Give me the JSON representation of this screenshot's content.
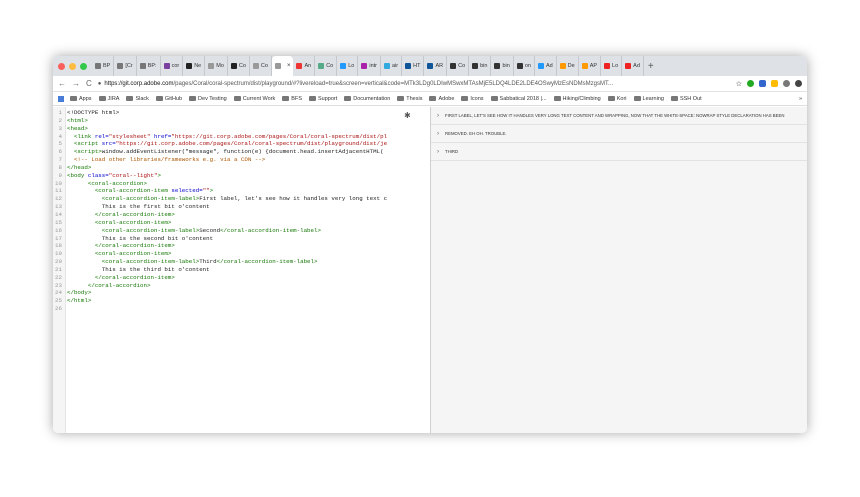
{
  "tabs": [
    {
      "label": "BP",
      "color": "#777"
    },
    {
      "label": "[Cr",
      "color": "#777"
    },
    {
      "label": "BP:",
      "color": "#777"
    },
    {
      "label": "cor",
      "color": "#7b3fa0"
    },
    {
      "label": "Ne",
      "color": "#222"
    },
    {
      "label": "Mo",
      "color": "#999"
    },
    {
      "label": "Co",
      "color": "#222"
    },
    {
      "label": "Co",
      "color": "#999"
    },
    {
      "label": "",
      "color": "#999",
      "active": true
    },
    {
      "label": "An",
      "color": "#e33"
    },
    {
      "label": "Co",
      "color": "#5a8"
    },
    {
      "label": "Lo",
      "color": "#29f"
    },
    {
      "label": "intr",
      "color": "#a2a"
    },
    {
      "label": "air",
      "color": "#3ad"
    },
    {
      "label": "HT",
      "color": "#159"
    },
    {
      "label": "AR",
      "color": "#159"
    },
    {
      "label": "Co",
      "color": "#333"
    },
    {
      "label": "bin",
      "color": "#333"
    },
    {
      "label": "bin",
      "color": "#333"
    },
    {
      "label": "on",
      "color": "#333"
    },
    {
      "label": "Ad",
      "color": "#29f"
    },
    {
      "label": "De",
      "color": "#f90"
    },
    {
      "label": "AP",
      "color": "#f90"
    },
    {
      "label": "Lo",
      "color": "#e22"
    },
    {
      "label": "Ad",
      "color": "#e22"
    }
  ],
  "active_tab_close": "×",
  "new_tab": "+",
  "url": {
    "host": "https://git.corp.adobe.com",
    "path": "/pages/Coral/coral-spectrum/dist/playground/#?livereload=true&screen=vertical&code=MTk3LDg0LDIwMSwxMTAsMjE5LDQ4LDE2LDE4OSwyMzEsNDMsMzgsMT..."
  },
  "bookmarks": [
    "Apps",
    "JIRA",
    "Slack",
    "GitHub",
    "Dev Testing",
    "Current Work",
    "BFS",
    "Support",
    "Documentation",
    "Thesis",
    "Adobe",
    "Icons",
    "Sabbatical 2018 |...",
    "Hiking/Climbing",
    "Kori",
    "Learning",
    "SSH Out"
  ],
  "bookmarks_more": "»",
  "code_lines": [
    [
      {
        "t": "<!DOCTYPE html>",
        "c": ""
      }
    ],
    [
      {
        "t": "<html>",
        "c": "tag"
      }
    ],
    [
      {
        "t": "<head>",
        "c": "tag"
      }
    ],
    [
      {
        "t": "  <link ",
        "c": "tag"
      },
      {
        "t": "rel=",
        "c": "attr"
      },
      {
        "t": "\"stylesheet\" ",
        "c": "str"
      },
      {
        "t": "href=",
        "c": "attr"
      },
      {
        "t": "\"https://git.corp.adobe.com/pages/Coral/coral-spectrum/dist/pl",
        "c": "str"
      }
    ],
    [
      {
        "t": "  <script ",
        "c": "tag"
      },
      {
        "t": "src=",
        "c": "attr"
      },
      {
        "t": "\"https://git.corp.adobe.com/pages/Coral/coral-spectrum/dist/playground/dist/je",
        "c": "str"
      }
    ],
    [
      {
        "t": "  <script>",
        "c": "tag"
      },
      {
        "t": "window.addEventListener(\"message\", function(e) {document.head.insertAdjacentHTML(",
        "c": ""
      }
    ],
    [
      {
        "t": "  <!-- Load other libraries/frameworks e.g. via a CDN -->",
        "c": "cmt"
      }
    ],
    [
      {
        "t": "</head>",
        "c": "tag"
      }
    ],
    [
      {
        "t": "<body ",
        "c": "tag"
      },
      {
        "t": "class=",
        "c": "attr"
      },
      {
        "t": "\"coral--light\"",
        "c": "str"
      },
      {
        "t": ">",
        "c": "tag"
      }
    ],
    [
      {
        "t": "      <coral-accordion>",
        "c": "tag"
      }
    ],
    [
      {
        "t": "        <coral-accordion-item ",
        "c": "tag"
      },
      {
        "t": "selected=",
        "c": "attr"
      },
      {
        "t": "\"\"",
        "c": "str"
      },
      {
        "t": ">",
        "c": "tag"
      }
    ],
    [
      {
        "t": "          <coral-accordion-item-label>",
        "c": "tag"
      },
      {
        "t": "First label, let's see how it handles very long text c",
        "c": ""
      }
    ],
    [
      {
        "t": "          This is the first bit o'content",
        "c": ""
      }
    ],
    [
      {
        "t": "        </coral-accordion-item>",
        "c": "tag"
      }
    ],
    [
      {
        "t": "        <coral-accordion-item>",
        "c": "tag"
      }
    ],
    [
      {
        "t": "          <coral-accordion-item-label>",
        "c": "tag"
      },
      {
        "t": "Second",
        "c": ""
      },
      {
        "t": "</coral-accordion-item-label>",
        "c": "tag"
      }
    ],
    [
      {
        "t": "          This is the second bit o'content",
        "c": ""
      }
    ],
    [
      {
        "t": "        </coral-accordion-item>",
        "c": "tag"
      }
    ],
    [
      {
        "t": "        <coral-accordion-item>",
        "c": "tag"
      }
    ],
    [
      {
        "t": "          <coral-accordion-item-label>",
        "c": "tag"
      },
      {
        "t": "Third",
        "c": ""
      },
      {
        "t": "</coral-accordion-item-label>",
        "c": "tag"
      }
    ],
    [
      {
        "t": "          This is the third bit o'content",
        "c": ""
      }
    ],
    [
      {
        "t": "        </coral-accordion-item>",
        "c": "tag"
      }
    ],
    [
      {
        "t": "      </coral-accordion>",
        "c": "tag"
      }
    ],
    [
      {
        "t": "</body>",
        "c": "tag"
      }
    ],
    [
      {
        "t": "</html>",
        "c": "tag"
      }
    ],
    [
      {
        "t": "",
        "c": ""
      }
    ]
  ],
  "accordion": [
    {
      "chevron": "›",
      "label": "FIRST LABEL, LET'S SEE HOW IT HANDLES VERY LONG TEXT CONTENT AND WRAPPING, NOW THAT THE WHITE-SPACE: NOWRAP STYLE DECLARATION HAS BEEN"
    },
    {
      "chevron": "›",
      "label": "REMOVED. EH OH. TROUBLE."
    },
    {
      "chevron": "›",
      "label": "THIRD"
    }
  ]
}
